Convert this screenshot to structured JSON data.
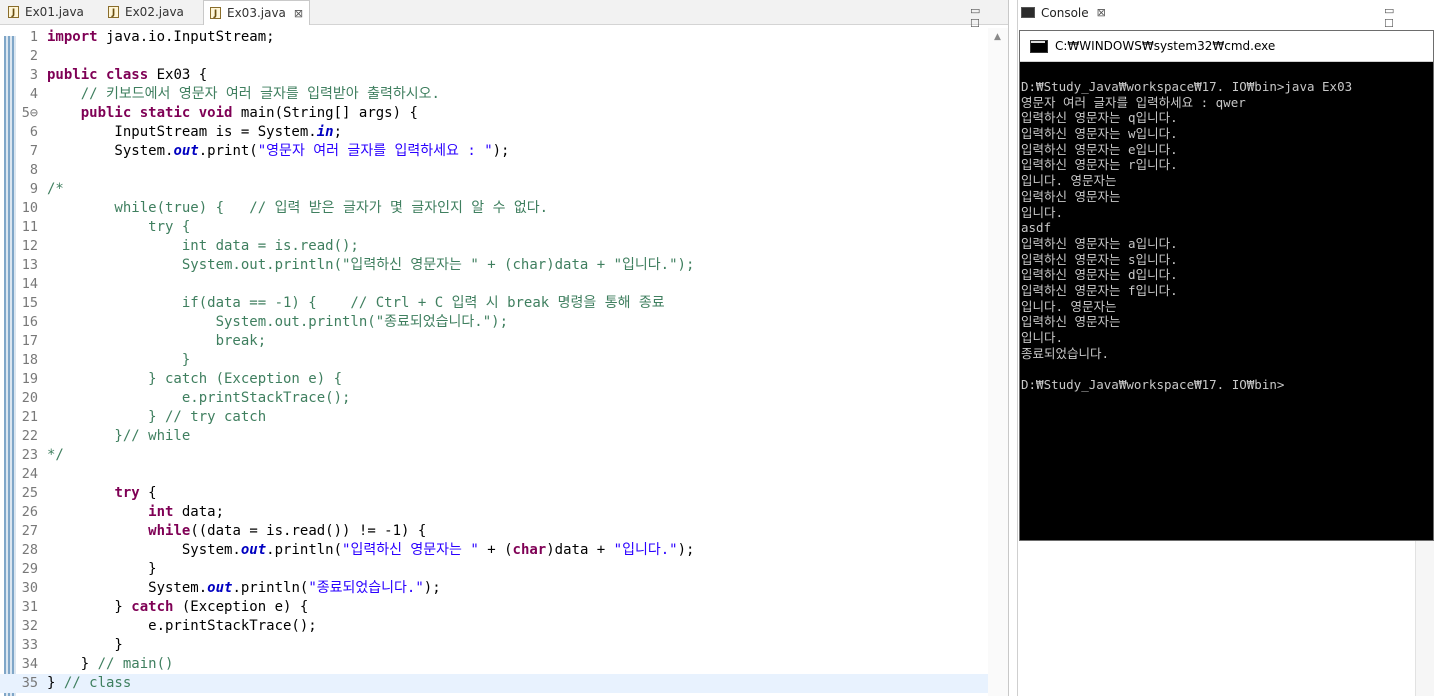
{
  "editor": {
    "tabs": [
      {
        "label": "Ex01.java",
        "active": false
      },
      {
        "label": "Ex02.java",
        "active": false
      },
      {
        "label": "Ex03.java",
        "active": true
      }
    ],
    "close_glyph": "⊠",
    "window_buttons": "▭ ☐",
    "scroll_up_glyph": "▲",
    "lines": [
      {
        "n": "1",
        "h": "<span class=\"kw\">import</span> java.io.InputStream;"
      },
      {
        "n": "2",
        "h": ""
      },
      {
        "n": "3",
        "h": "<span class=\"kw\">public</span> <span class=\"kw\">class</span> Ex03 {"
      },
      {
        "n": "4",
        "h": "    <span class=\"cm\">// 키보드에서 영문자 여러 글자를 입력받아 출력하시오.</span>"
      },
      {
        "n": "5⊖",
        "h": "    <span class=\"kw\">public</span> <span class=\"kw\">static</span> <span class=\"kw\">void</span> main(String[] args) {"
      },
      {
        "n": "6",
        "h": "        InputStream is = System.<span class=\"fld\">in</span>;"
      },
      {
        "n": "7",
        "h": "        System.<span class=\"fld\">out</span>.print(<span class=\"st\">\"영문자 여러 글자를 입력하세요 : \"</span>);"
      },
      {
        "n": "8",
        "h": ""
      },
      {
        "n": "9",
        "h": "<span class=\"cm\">/*</span>"
      },
      {
        "n": "10",
        "h": "<span class=\"cm\">        while(true) {   // 입력 받은 글자가 몇 글자인지 알 수 없다.</span>"
      },
      {
        "n": "11",
        "h": "<span class=\"cm\">            try {</span>"
      },
      {
        "n": "12",
        "h": "<span class=\"cm\">                int data = is.read();</span>"
      },
      {
        "n": "13",
        "h": "<span class=\"cm\">                System.out.println(\"입력하신 영문자는 \" + (char)data + \"입니다.\");</span>"
      },
      {
        "n": "14",
        "h": ""
      },
      {
        "n": "15",
        "h": "<span class=\"cm\">                if(data == -1) {    // Ctrl + C 입력 시 break 명령을 통해 종료</span>"
      },
      {
        "n": "16",
        "h": "<span class=\"cm\">                    System.out.println(\"종료되었습니다.\");</span>"
      },
      {
        "n": "17",
        "h": "<span class=\"cm\">                    break;</span>"
      },
      {
        "n": "18",
        "h": "<span class=\"cm\">                }</span>"
      },
      {
        "n": "19",
        "h": "<span class=\"cm\">            } catch (Exception e) {</span>"
      },
      {
        "n": "20",
        "h": "<span class=\"cm\">                e.printStackTrace();</span>"
      },
      {
        "n": "21",
        "h": "<span class=\"cm\">            } // try catch</span>"
      },
      {
        "n": "22",
        "h": "<span class=\"cm\">        }// while</span>"
      },
      {
        "n": "23",
        "h": "<span class=\"cm\">*/</span>"
      },
      {
        "n": "24",
        "h": ""
      },
      {
        "n": "25",
        "h": "        <span class=\"kw\">try</span> {"
      },
      {
        "n": "26",
        "h": "            <span class=\"kw\">int</span> data;"
      },
      {
        "n": "27",
        "h": "            <span class=\"kw\">while</span>((data = is.read()) != -1) {"
      },
      {
        "n": "28",
        "h": "                System.<span class=\"fld\">out</span>.println(<span class=\"st\">\"입력하신 영문자는 \"</span> + (<span class=\"kw\">char</span>)data + <span class=\"st\">\"입니다.\"</span>);"
      },
      {
        "n": "29",
        "h": "            }"
      },
      {
        "n": "30",
        "h": "            System.<span class=\"fld\">out</span>.println(<span class=\"st\">\"종료되었습니다.\"</span>);"
      },
      {
        "n": "31",
        "h": "        } <span class=\"kw\">catch</span> (Exception e) {"
      },
      {
        "n": "32",
        "h": "            e.printStackTrace();"
      },
      {
        "n": "33",
        "h": "        }"
      },
      {
        "n": "34",
        "h": "    } <span class=\"cm\">// main()</span>"
      },
      {
        "n": "35",
        "h": "} <span class=\"cm\">// class</span>"
      }
    ]
  },
  "console": {
    "tab_label": "Console",
    "close_glyph": "⊠",
    "window_buttons": "▭ ☐"
  },
  "cmd": {
    "title": "C:₩WINDOWS₩system32₩cmd.exe",
    "lines": [
      "D:₩Study_Java₩workspace₩17. IO₩bin>java Ex03",
      "영문자 여러 글자를 입력하세요 : qwer",
      "입력하신 영문자는 q입니다.",
      "입력하신 영문자는 w입니다.",
      "입력하신 영문자는 e입니다.",
      "입력하신 영문자는 r입니다.",
      "입니다. 영문자는",
      "입력하신 영문자는",
      "입니다.",
      "asdf",
      "입력하신 영문자는 a입니다.",
      "입력하신 영문자는 s입니다.",
      "입력하신 영문자는 d입니다.",
      "입력하신 영문자는 f입니다.",
      "입니다. 영문자는",
      "입력하신 영문자는",
      "입니다.",
      "종료되었습니다.",
      "",
      "D:₩Study_Java₩workspace₩17. IO₩bin>"
    ]
  }
}
